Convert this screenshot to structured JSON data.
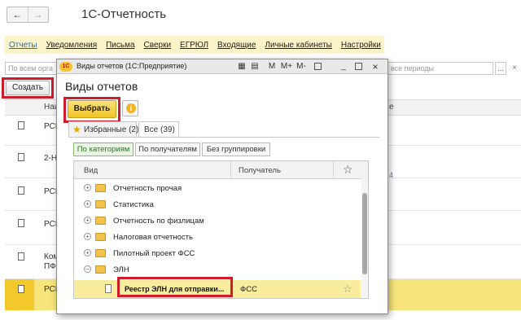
{
  "app": {
    "title": "1С-Отчетность",
    "back_icon": "←",
    "forward_icon": "→"
  },
  "menu": {
    "items": [
      "Отчеты",
      "Уведомления",
      "Письма",
      "Сверки",
      "ЕГРЮЛ",
      "Входящие",
      "Личные кабинеты",
      "Настройки"
    ]
  },
  "search": {
    "placeholder": "По всем орга"
  },
  "period": {
    "placeholder": "все периоды",
    "select_label": "...",
    "clear_label": "×"
  },
  "toolbar": {
    "create_label": "Создать"
  },
  "table": {
    "col_name": "Наи",
    "col_right": "е",
    "rows": [
      "РСВ",
      "2-НД",
      "РСВ",
      "РСВ",
      "Ком",
      "ПФ",
      "РСВ"
    ],
    "right_value": "4"
  },
  "dialog": {
    "window_title": "Виды отчетов  (1С:Предприятие)",
    "title": "Виды отчетов",
    "choose_label": "Выбрать",
    "titlebar_buttons": [
      "M",
      "M+",
      "M-",
      "▢",
      "_",
      "▢",
      "×"
    ],
    "tabs": {
      "favorites": "Избранные (2)",
      "all": "Все (39)"
    },
    "grouping": [
      "По категориям",
      "По получателям",
      "Без группировки"
    ],
    "list_headers": {
      "kind": "Вид",
      "recipient": "Получатель"
    },
    "tree": [
      {
        "label": "Отчетность прочая",
        "expander": "+"
      },
      {
        "label": "Статистика",
        "expander": "+"
      },
      {
        "label": "Отчетность по физлицам",
        "expander": "+"
      },
      {
        "label": "Налоговая отчетность",
        "expander": "+"
      },
      {
        "label": "Пилотный проект ФСС",
        "expander": "+"
      },
      {
        "label": "ЭЛН",
        "expander": "−"
      }
    ],
    "selected_item": {
      "label": "Реестр ЭЛН для отправки...",
      "recipient": "ФСС"
    }
  }
}
